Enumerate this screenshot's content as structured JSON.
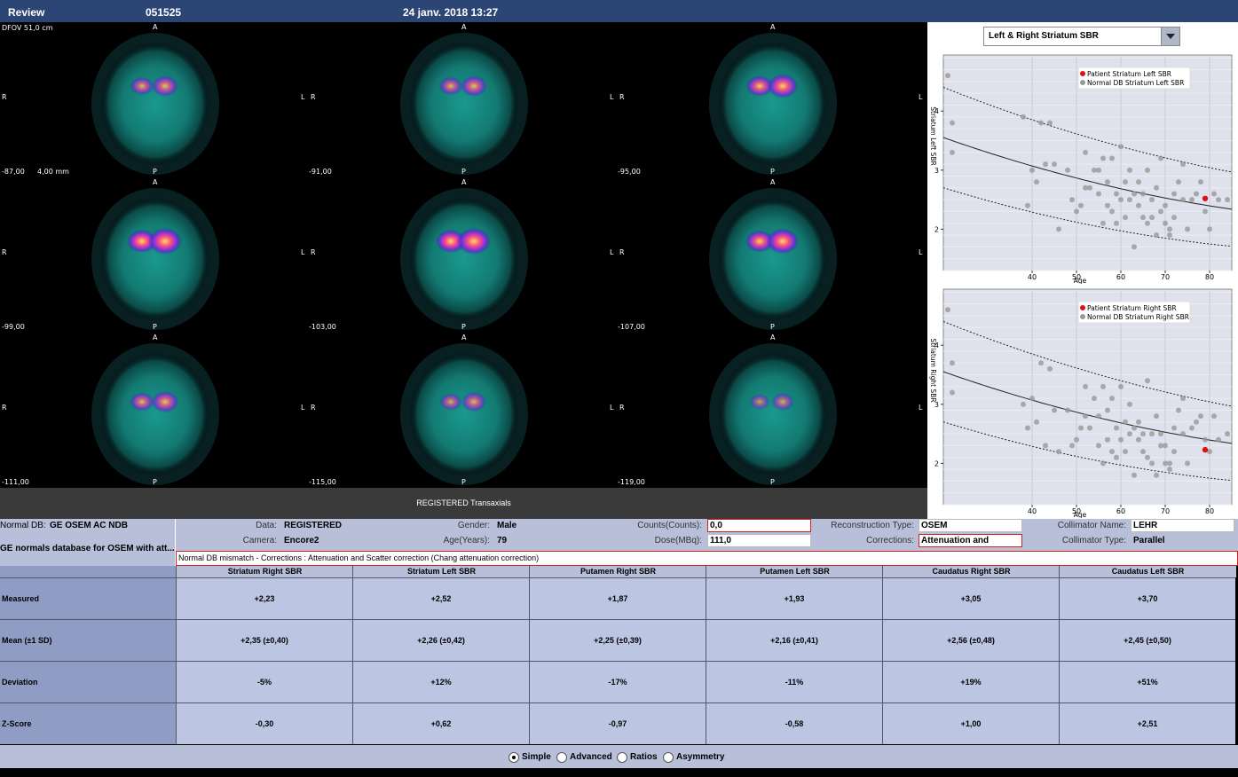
{
  "header": {
    "title": "Review",
    "patient_id": "051525",
    "datetime": "24 janv. 2018 13:27"
  },
  "images": {
    "dfov": "DFOV 51,0 cm",
    "thickness": "4,00 mm",
    "orient_top": "A",
    "orient_bottom": "P",
    "orient_left": "R",
    "orient_right": "L",
    "slices": [
      {
        "pos": "-87,00",
        "intensity": 0.55
      },
      {
        "pos": "-91,00",
        "intensity": 0.55
      },
      {
        "pos": "-95,00",
        "intensity": 0.8
      },
      {
        "pos": "-99,00",
        "intensity": 1.0
      },
      {
        "pos": "-103,00",
        "intensity": 1.0
      },
      {
        "pos": "-107,00",
        "intensity": 0.9
      },
      {
        "pos": "-111,00",
        "intensity": 0.6
      },
      {
        "pos": "-115,00",
        "intensity": 0.45
      },
      {
        "pos": "-119,00",
        "intensity": 0.3
      }
    ],
    "strip_label": "REGISTERED Transaxials"
  },
  "chart_selector": {
    "value": "Left & Right Striatum SBR"
  },
  "chart_data": [
    {
      "type": "scatter",
      "ylabel": "Striatum Left SBR",
      "xlabel": "Age",
      "xlim": [
        20,
        85
      ],
      "ylim": [
        1.3,
        4.95
      ],
      "xticks": [
        40,
        50,
        60,
        70,
        80
      ],
      "yticks": [
        2,
        3,
        4
      ],
      "legend": [
        "Patient Striatum Left SBR",
        "Normal DB Striatum Left SBR"
      ],
      "patient": {
        "x": 79,
        "y": 2.52
      },
      "normals": [
        [
          21,
          4.6
        ],
        [
          22,
          3.8
        ],
        [
          22,
          3.3
        ],
        [
          38,
          3.9
        ],
        [
          39,
          2.4
        ],
        [
          40,
          3.0
        ],
        [
          41,
          2.8
        ],
        [
          42,
          3.8
        ],
        [
          43,
          3.1
        ],
        [
          44,
          3.8
        ],
        [
          45,
          3.1
        ],
        [
          46,
          2.0
        ],
        [
          48,
          3.0
        ],
        [
          49,
          2.5
        ],
        [
          50,
          2.3
        ],
        [
          51,
          2.4
        ],
        [
          52,
          2.7
        ],
        [
          52,
          3.3
        ],
        [
          53,
          2.7
        ],
        [
          54,
          3.0
        ],
        [
          55,
          3.0
        ],
        [
          55,
          2.6
        ],
        [
          56,
          2.1
        ],
        [
          56,
          3.2
        ],
        [
          57,
          2.4
        ],
        [
          57,
          2.8
        ],
        [
          58,
          2.3
        ],
        [
          58,
          3.2
        ],
        [
          59,
          2.6
        ],
        [
          59,
          2.1
        ],
        [
          60,
          3.4
        ],
        [
          60,
          2.5
        ],
        [
          61,
          2.8
        ],
        [
          61,
          2.2
        ],
        [
          62,
          2.5
        ],
        [
          62,
          3.0
        ],
        [
          63,
          1.7
        ],
        [
          63,
          2.6
        ],
        [
          64,
          2.4
        ],
        [
          64,
          2.8
        ],
        [
          65,
          2.2
        ],
        [
          65,
          2.6
        ],
        [
          66,
          3.0
        ],
        [
          66,
          2.1
        ],
        [
          67,
          2.5
        ],
        [
          67,
          2.2
        ],
        [
          68,
          2.7
        ],
        [
          68,
          1.9
        ],
        [
          69,
          2.3
        ],
        [
          69,
          3.2
        ],
        [
          70,
          2.1
        ],
        [
          70,
          2.4
        ],
        [
          71,
          2.0
        ],
        [
          71,
          1.9
        ],
        [
          72,
          2.2
        ],
        [
          72,
          2.6
        ],
        [
          73,
          2.8
        ],
        [
          74,
          3.1
        ],
        [
          74,
          2.5
        ],
        [
          75,
          2.0
        ],
        [
          76,
          2.5
        ],
        [
          77,
          2.6
        ],
        [
          78,
          2.8
        ],
        [
          79,
          2.3
        ],
        [
          80,
          2.0
        ],
        [
          81,
          2.6
        ],
        [
          82,
          2.5
        ],
        [
          84,
          2.5
        ]
      ]
    },
    {
      "type": "scatter",
      "ylabel": "Striatum Right SBR",
      "xlabel": "Age",
      "xlim": [
        20,
        85
      ],
      "ylim": [
        1.3,
        4.95
      ],
      "xticks": [
        40,
        50,
        60,
        70,
        80
      ],
      "yticks": [
        2,
        3,
        4
      ],
      "legend": [
        "Patient Striatum Right SBR",
        "Normal DB Striatum Right SBR"
      ],
      "patient": {
        "x": 79,
        "y": 2.23
      },
      "normals": [
        [
          21,
          4.6
        ],
        [
          22,
          3.7
        ],
        [
          22,
          3.2
        ],
        [
          38,
          3.0
        ],
        [
          39,
          2.6
        ],
        [
          40,
          3.1
        ],
        [
          41,
          2.7
        ],
        [
          42,
          3.7
        ],
        [
          43,
          2.3
        ],
        [
          44,
          3.6
        ],
        [
          45,
          2.9
        ],
        [
          46,
          2.2
        ],
        [
          48,
          2.9
        ],
        [
          49,
          2.3
        ],
        [
          50,
          2.4
        ],
        [
          51,
          2.6
        ],
        [
          52,
          2.8
        ],
        [
          52,
          3.3
        ],
        [
          53,
          2.6
        ],
        [
          54,
          3.1
        ],
        [
          55,
          2.8
        ],
        [
          55,
          2.3
        ],
        [
          56,
          2.0
        ],
        [
          56,
          3.3
        ],
        [
          57,
          2.4
        ],
        [
          57,
          2.9
        ],
        [
          58,
          2.2
        ],
        [
          58,
          3.1
        ],
        [
          59,
          2.6
        ],
        [
          59,
          2.1
        ],
        [
          60,
          3.3
        ],
        [
          60,
          2.4
        ],
        [
          61,
          2.7
        ],
        [
          61,
          2.2
        ],
        [
          62,
          2.5
        ],
        [
          62,
          3.0
        ],
        [
          63,
          1.8
        ],
        [
          63,
          2.6
        ],
        [
          64,
          2.4
        ],
        [
          64,
          2.7
        ],
        [
          65,
          2.2
        ],
        [
          65,
          2.5
        ],
        [
          66,
          3.4
        ],
        [
          66,
          2.1
        ],
        [
          67,
          2.5
        ],
        [
          67,
          2.0
        ],
        [
          68,
          2.8
        ],
        [
          68,
          1.8
        ],
        [
          69,
          2.3
        ],
        [
          69,
          2.5
        ],
        [
          70,
          2.0
        ],
        [
          70,
          2.3
        ],
        [
          71,
          1.9
        ],
        [
          71,
          2.0
        ],
        [
          72,
          2.2
        ],
        [
          72,
          2.6
        ],
        [
          73,
          2.9
        ],
        [
          74,
          3.1
        ],
        [
          74,
          2.5
        ],
        [
          75,
          2.0
        ],
        [
          76,
          2.6
        ],
        [
          77,
          2.7
        ],
        [
          78,
          2.8
        ],
        [
          79,
          2.4
        ],
        [
          80,
          2.2
        ],
        [
          81,
          2.8
        ],
        [
          82,
          2.4
        ],
        [
          84,
          2.5
        ]
      ]
    }
  ],
  "info": {
    "normal_db_label": "Normal DB:",
    "normal_db_value": "GE OSEM AC NDB",
    "normal_db_desc": "GE normals database for OSEM with att...",
    "data_label": "Data:",
    "data_value": "REGISTERED",
    "camera_label": "Camera:",
    "camera_value": "Encore2",
    "gender_label": "Gender:",
    "gender_value": "Male",
    "age_label": "Age(Years):",
    "age_value": "79",
    "counts_label": "Counts(Counts):",
    "counts_value": "0,0",
    "dose_label": "Dose(MBq):",
    "dose_value": "111,0",
    "recon_label": "Reconstruction Type:",
    "recon_value": "OSEM",
    "corrections_label": "Corrections:",
    "corrections_value": "Attenuation and",
    "collimator_name_label": "Collimator Name:",
    "collimator_name_value": "LEHR",
    "collimator_type_label": "Collimator Type:",
    "collimator_type_value": "Parallel",
    "mismatch": "Normal DB mismatch -  Corrections : Attenuation and Scatter correction (Chang attenuation correction)"
  },
  "table": {
    "columns": [
      "Striatum Right SBR",
      "Striatum Left SBR",
      "Putamen Right SBR",
      "Putamen Left SBR",
      "Caudatus Right SBR",
      "Caudatus Left SBR"
    ],
    "rows": [
      {
        "label": "Measured",
        "values": [
          "+2,23",
          "+2,52",
          "+1,87",
          "+1,93",
          "+3,05",
          "+3,70"
        ]
      },
      {
        "label": "Mean (±1 SD)",
        "values": [
          "+2,35 (±0,40)",
          "+2,26 (±0,42)",
          "+2,25 (±0,39)",
          "+2,16 (±0,41)",
          "+2,56 (±0,48)",
          "+2,45 (±0,50)"
        ]
      },
      {
        "label": "Deviation",
        "values": [
          "-5%",
          "+12%",
          "-17%",
          "-11%",
          "+19%",
          "+51%"
        ]
      },
      {
        "label": "Z-Score",
        "values": [
          "-0,30",
          "+0,62",
          "-0,97",
          "-0,58",
          "+1,00",
          "+2,51"
        ]
      }
    ]
  },
  "modes": [
    {
      "label": "Simple",
      "selected": true
    },
    {
      "label": "Advanced",
      "selected": false
    },
    {
      "label": "Ratios",
      "selected": false
    },
    {
      "label": "Asymmetry",
      "selected": false
    }
  ]
}
